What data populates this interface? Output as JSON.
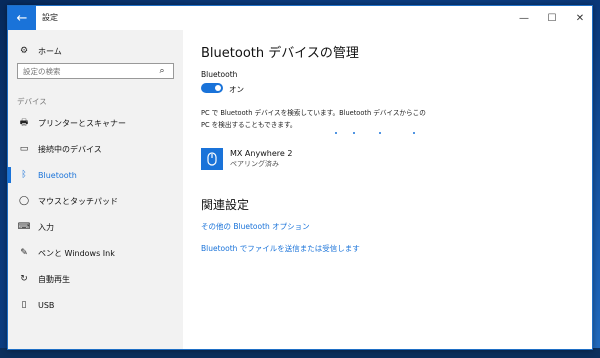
{
  "window": {
    "title": "設定",
    "back_icon": "back-arrow-icon",
    "minimize_glyph": "—",
    "maximize_glyph": "☐",
    "close_glyph": "✕"
  },
  "sidebar": {
    "home_label": "ホーム",
    "search_placeholder": "設定の検索",
    "section_label": "デバイス",
    "items": [
      {
        "label": "プリンターとスキャナー",
        "icon": "printer-icon",
        "glyph": "🖶"
      },
      {
        "label": "接続中のデバイス",
        "icon": "connected-devices-icon",
        "glyph": "▭"
      },
      {
        "label": "Bluetooth",
        "icon": "bluetooth-icon",
        "glyph": "ᛒ"
      },
      {
        "label": "マウスとタッチパッド",
        "icon": "mouse-icon",
        "glyph": "◯"
      },
      {
        "label": "入力",
        "icon": "keyboard-icon",
        "glyph": "⌨"
      },
      {
        "label": "ペンと Windows Ink",
        "icon": "pen-icon",
        "glyph": "✎"
      },
      {
        "label": "自動再生",
        "icon": "autoplay-icon",
        "glyph": "↻"
      },
      {
        "label": "USB",
        "icon": "usb-icon",
        "glyph": "▯"
      }
    ],
    "active_index": 2
  },
  "main": {
    "title": "Bluetooth デバイスの管理",
    "toggle_label": "Bluetooth",
    "toggle_state": "オン",
    "description": "PC で Bluetooth デバイスを検索しています。Bluetooth デバイスからこの PC を検出することもできます。",
    "device": {
      "name": "MX Anywhere 2",
      "status": "ペアリング済み"
    },
    "related_title": "関連設定",
    "links": [
      "その他の Bluetooth オプション",
      "Bluetooth でファイルを送信または受信します"
    ]
  },
  "colors": {
    "accent": "#1a73d9",
    "sidebar_bg": "#f2f2f2"
  }
}
